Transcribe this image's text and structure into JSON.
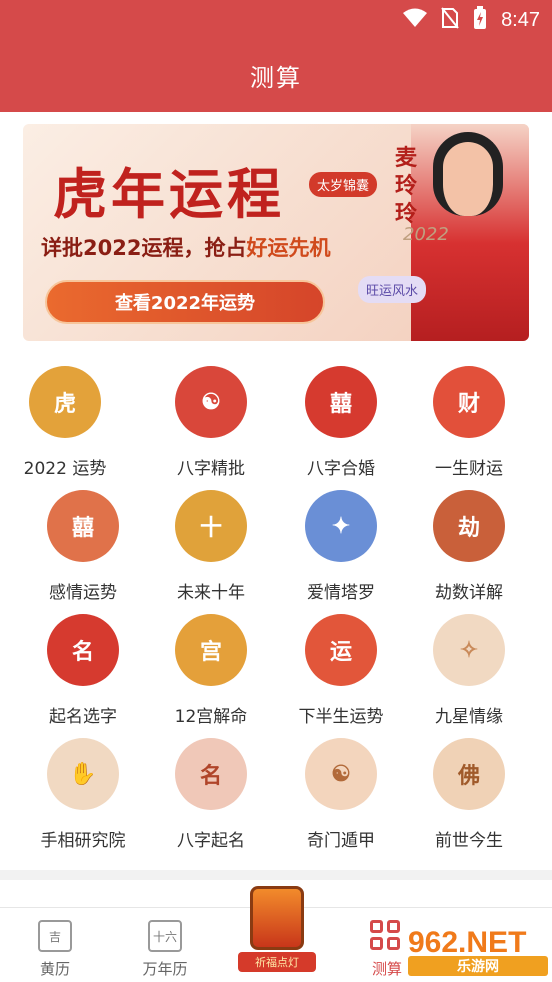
{
  "status": {
    "time": "8:47"
  },
  "header": {
    "title": "测算"
  },
  "banner": {
    "title": "虎年运程",
    "tag": "太岁锦囊",
    "name": "麦玲玲",
    "year": "2022",
    "subtitle_a": "详批2022运程，抢占",
    "subtitle_b": "好运先机",
    "button": "查看2022年运势",
    "badge": "旺运风水"
  },
  "grid": [
    [
      {
        "label": "2022 运势",
        "icon": "tiger-year-fortune-icon",
        "glyph": "虎",
        "color": "#e3a23a"
      },
      {
        "label": "八字精批",
        "icon": "yin-yang-icon",
        "glyph": "☯",
        "color": "#d9473a"
      },
      {
        "label": "八字合婚",
        "icon": "double-happiness-icon",
        "glyph": "囍",
        "color": "#d63a2f"
      },
      {
        "label": "一生财运",
        "icon": "money-bag-icon",
        "glyph": "财",
        "color": "#e2503a"
      }
    ],
    [
      {
        "label": "感情运势",
        "icon": "love-letter-icon",
        "glyph": "囍",
        "color": "#e0724a"
      },
      {
        "label": "未来十年",
        "icon": "treasure-icon",
        "glyph": "十",
        "color": "#e0a23a"
      },
      {
        "label": "爱情塔罗",
        "icon": "tarot-icon",
        "glyph": "✦",
        "color": "#6a8fd6"
      },
      {
        "label": "劫数详解",
        "icon": "book-icon",
        "glyph": "劫",
        "color": "#c9603a"
      }
    ],
    [
      {
        "label": "起名选字",
        "icon": "naming-icon",
        "glyph": "名",
        "color": "#d63a2f"
      },
      {
        "label": "12宫解命",
        "icon": "zodiac-palace-icon",
        "glyph": "宫",
        "color": "#e4a03a"
      },
      {
        "label": "下半生运势",
        "icon": "fortune-scroll-icon",
        "glyph": "运",
        "color": "#e2563a"
      },
      {
        "label": "九星情缘",
        "icon": "nine-star-icon",
        "glyph": "✧",
        "color": "#f1d9c2"
      }
    ],
    [
      {
        "label": "手相研究院",
        "icon": "palm-icon",
        "glyph": "✋",
        "color": "#f1d9c2"
      },
      {
        "label": "八字起名",
        "icon": "naming-paper-icon",
        "glyph": "名",
        "color": "#f0c8b8"
      },
      {
        "label": "奇门遁甲",
        "icon": "bagua-icon",
        "glyph": "☯",
        "color": "#f3d5bd"
      },
      {
        "label": "前世今生",
        "icon": "buddha-icon",
        "glyph": "佛",
        "color": "#f0d2b6"
      }
    ]
  ],
  "tabbar": {
    "huangli": {
      "label": "黄历",
      "glyph": "吉"
    },
    "wannianli": {
      "label": "万年历",
      "glyph": "十六"
    },
    "lantern": {
      "label": "祈福点灯"
    },
    "cesuan": {
      "label": "测算"
    }
  },
  "watermark": {
    "brand": "962.NET",
    "sub": "乐游网"
  }
}
